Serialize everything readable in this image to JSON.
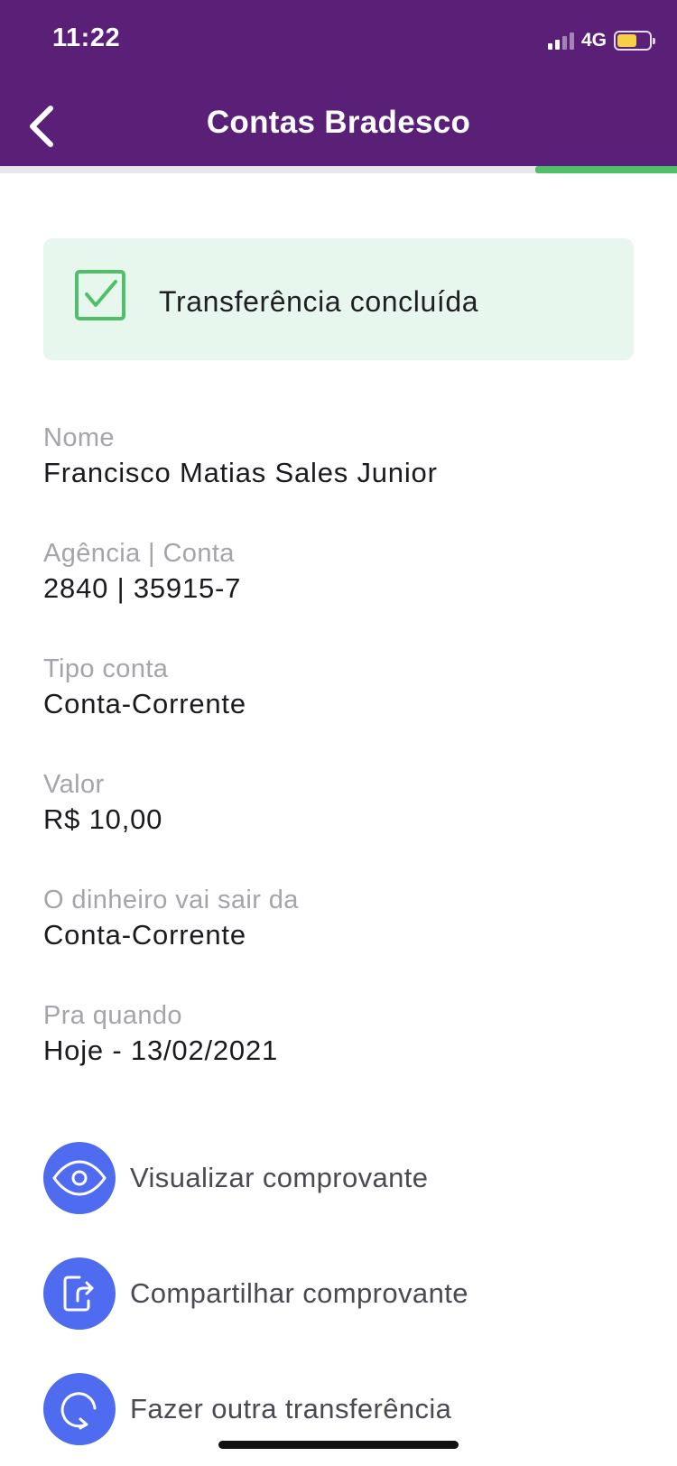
{
  "status_bar": {
    "time": "11:22",
    "network": "4G",
    "battery_level": 0.62
  },
  "nav": {
    "title": "Contas Bradesco",
    "back_icon": "chevron-left-icon",
    "progress": 0.21,
    "header_color": "#5a2077",
    "progress_color": "#4fc068"
  },
  "banner": {
    "text": "Transferência concluída",
    "icon": "check-square-icon",
    "color": "#4fc068"
  },
  "details": [
    {
      "label": "Nome",
      "value": "Francisco Matias Sales Junior"
    },
    {
      "label": "Agência | Conta",
      "value": "2840 | 35915-7"
    },
    {
      "label": "Tipo conta",
      "value": "Conta-Corrente"
    },
    {
      "label": "Valor",
      "value": "R$ 10,00"
    },
    {
      "label": "O dinheiro vai sair da",
      "value": "Conta-Corrente"
    },
    {
      "label": "Pra quando",
      "value": "Hoje - 13/02/2021"
    }
  ],
  "actions": [
    {
      "label": "Visualizar comprovante",
      "icon": "eye-icon"
    },
    {
      "label": "Compartilhar comprovante",
      "icon": "share-icon"
    },
    {
      "label": "Fazer outra transferência",
      "icon": "refresh-icon"
    }
  ],
  "accent_color": "#4f6bf0"
}
